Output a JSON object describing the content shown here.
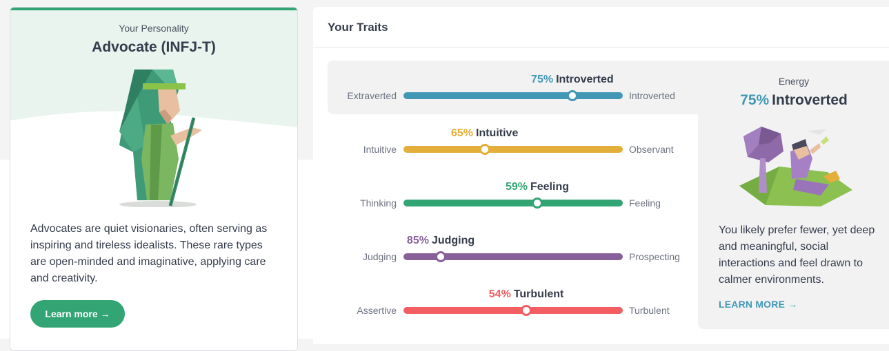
{
  "personality_card": {
    "label": "Your Personality",
    "type_name": "Advocate (INFJ-T)",
    "description": "Advocates are quiet visionaries, often serving as inspiring and tireless idealists. These rare types are open-minded and imaginative, applying care and creativity.",
    "button_label": "Learn more →",
    "accent_color": "#33a474"
  },
  "traits_panel": {
    "title": "Your Traits",
    "traits": [
      {
        "percent_text": "75%",
        "name": "Introverted",
        "left_label": "Extraverted",
        "right_label": "Introverted",
        "knob_position_pct": 77,
        "color": "#4298b4",
        "active": true
      },
      {
        "percent_text": "65%",
        "name": "Intuitive",
        "left_label": "Intuitive",
        "right_label": "Observant",
        "knob_position_pct": 37,
        "color": "#e4ae3a",
        "active": false
      },
      {
        "percent_text": "59%",
        "name": "Feeling",
        "left_label": "Thinking",
        "right_label": "Feeling",
        "knob_position_pct": 61,
        "color": "#33a474",
        "active": false
      },
      {
        "percent_text": "85%",
        "name": "Judging",
        "left_label": "Judging",
        "right_label": "Prospecting",
        "knob_position_pct": 17,
        "color": "#88619a",
        "active": false
      },
      {
        "percent_text": "54%",
        "name": "Turbulent",
        "left_label": "Assertive",
        "right_label": "Turbulent",
        "knob_position_pct": 56,
        "color": "#f25e62",
        "active": false
      }
    ]
  },
  "detail_card": {
    "label": "Energy",
    "percent_text": "75%",
    "name": "Introverted",
    "description": "You likely prefer fewer, yet deep and meaningful, social interactions and feel drawn to calmer environments.",
    "link_label": "LEARN MORE →",
    "accent_color": "#4298b4"
  }
}
